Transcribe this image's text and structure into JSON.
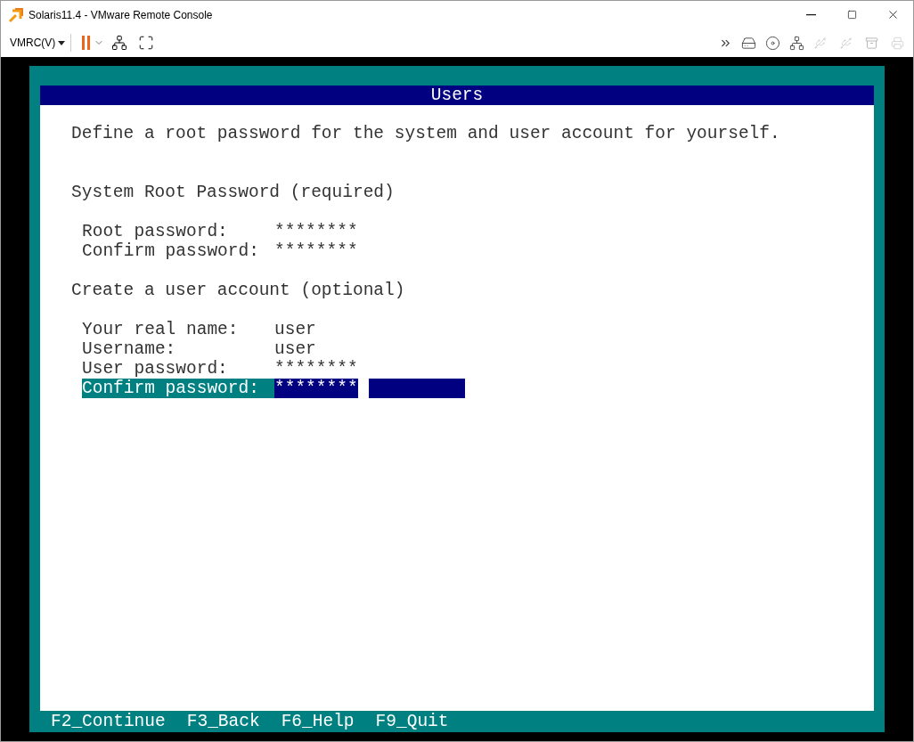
{
  "window": {
    "title": "Solaris11.4 - VMware Remote Console"
  },
  "toolbar": {
    "menu": "VMRC(V)"
  },
  "screen": {
    "title": "Users",
    "intro": "Define a root password for the system and user account for yourself.",
    "sections": [
      {
        "heading": "System Root Password (required)",
        "fields": [
          {
            "label": "Root password:",
            "value": "********",
            "selected": false
          },
          {
            "label": "Confirm password:",
            "value": "********",
            "selected": false
          }
        ]
      },
      {
        "heading": "Create a user account (optional)",
        "fields": [
          {
            "label": "Your real name:",
            "value": "user",
            "selected": false
          },
          {
            "label": "Username:",
            "value": "user",
            "selected": false
          },
          {
            "label": "User password:",
            "value": "********",
            "selected": false
          },
          {
            "label": "Confirm password:",
            "value": "********",
            "selected": true
          }
        ]
      }
    ],
    "keys": [
      "F2_Continue",
      "F3_Back",
      "F6_Help",
      "F9_Quit"
    ]
  }
}
